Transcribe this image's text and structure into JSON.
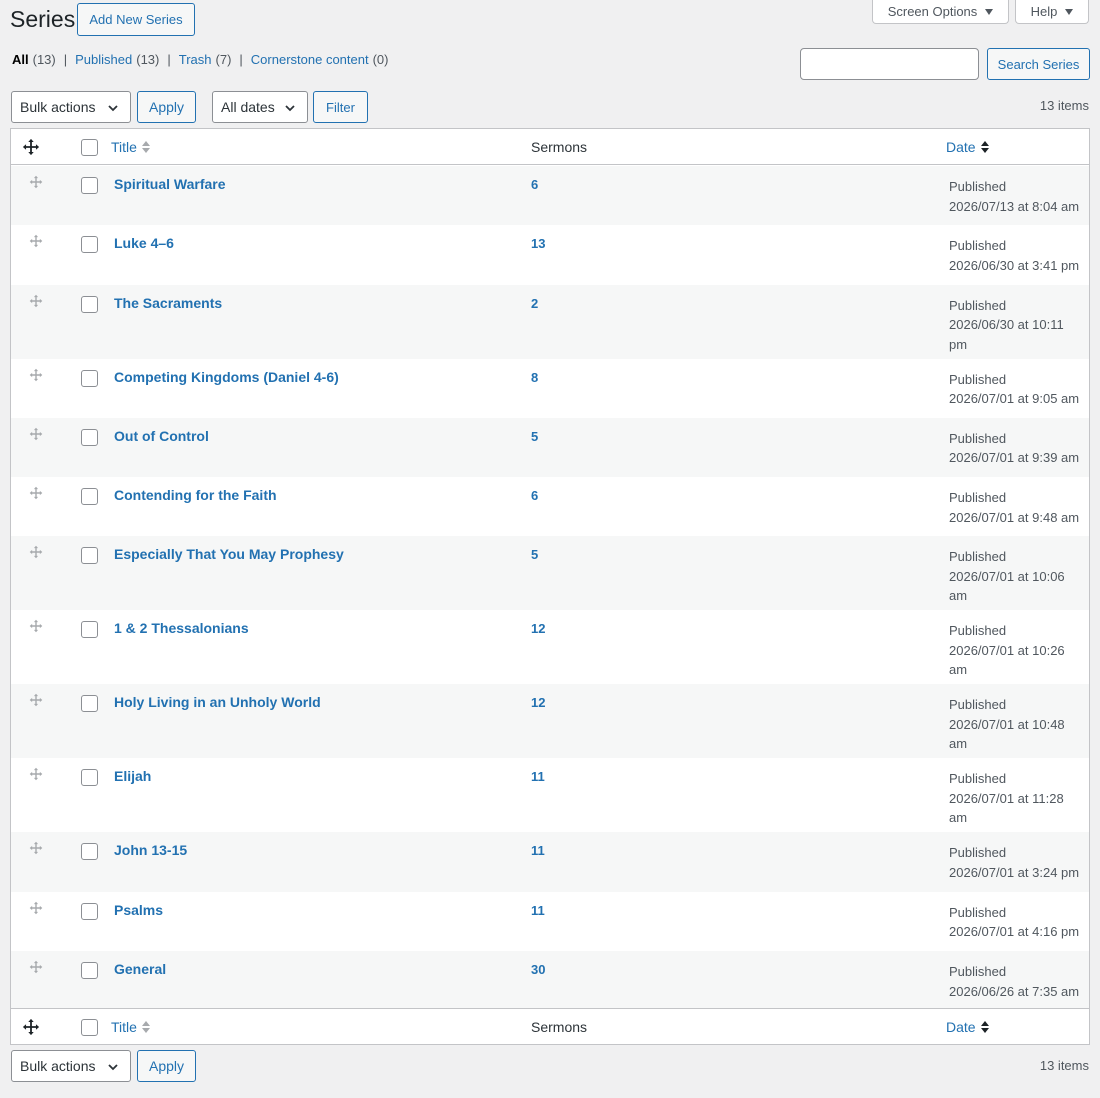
{
  "header": {
    "title": "Series",
    "add_new_label": "Add New Series",
    "screen_options_label": "Screen Options",
    "help_label": "Help"
  },
  "views": {
    "all": {
      "label": "All",
      "count": "(13)"
    },
    "published": {
      "label": "Published",
      "count": "(13)"
    },
    "trash": {
      "label": "Trash",
      "count": "(7)"
    },
    "cornerstone": {
      "label": "Cornerstone content",
      "count": "(0)"
    },
    "separator": "|"
  },
  "search": {
    "placeholder": "",
    "button_label": "Search Series"
  },
  "toolbar": {
    "bulk_actions": "Bulk actions",
    "apply": "Apply",
    "dates": "All dates",
    "filter": "Filter",
    "items_count": "13 items"
  },
  "table": {
    "columns": {
      "title": "Title",
      "sermons": "Sermons",
      "date": "Date"
    },
    "rows": [
      {
        "title": "Spiritual Warfare",
        "sermons": "6",
        "status": "Published",
        "date": "2026/07/13 at 8:04 am"
      },
      {
        "title": "Luke 4–6",
        "sermons": "13",
        "status": "Published",
        "date": "2026/06/30 at 3:41 pm"
      },
      {
        "title": "The Sacraments",
        "sermons": "2",
        "status": "Published",
        "date": "2026/06/30 at 10:11 pm"
      },
      {
        "title": "Competing Kingdoms (Daniel 4-6)",
        "sermons": "8",
        "status": "Published",
        "date": "2026/07/01 at 9:05 am"
      },
      {
        "title": "Out of Control",
        "sermons": "5",
        "status": "Published",
        "date": "2026/07/01 at 9:39 am"
      },
      {
        "title": "Contending for the Faith",
        "sermons": "6",
        "status": "Published",
        "date": "2026/07/01 at 9:48 am"
      },
      {
        "title": "Especially That You May Prophesy",
        "sermons": "5",
        "status": "Published",
        "date": "2026/07/01 at 10:06 am"
      },
      {
        "title": "1 & 2 Thessalonians",
        "sermons": "12",
        "status": "Published",
        "date": "2026/07/01 at 10:26 am"
      },
      {
        "title": "Holy Living in an Unholy World",
        "sermons": "12",
        "status": "Published",
        "date": "2026/07/01 at 10:48 am"
      },
      {
        "title": "Elijah",
        "sermons": "11",
        "status": "Published",
        "date": "2026/07/01 at 11:28 am"
      },
      {
        "title": "John 13-15",
        "sermons": "11",
        "status": "Published",
        "date": "2026/07/01 at 3:24 pm"
      },
      {
        "title": "Psalms",
        "sermons": "11",
        "status": "Published",
        "date": "2026/07/01 at 4:16 pm"
      },
      {
        "title": "General",
        "sermons": "30",
        "status": "Published",
        "date": "2026/06/26 at 7:35 am"
      }
    ]
  },
  "colors": {
    "accent": "#2271b1",
    "text": "#3c434a",
    "background": "#f0f0f1",
    "row_alt": "#f6f7f7"
  },
  "icons": {
    "move": "move-arrows-icon",
    "dropdown": "chevron-down-icon",
    "sort": "sort-arrows-icon"
  }
}
